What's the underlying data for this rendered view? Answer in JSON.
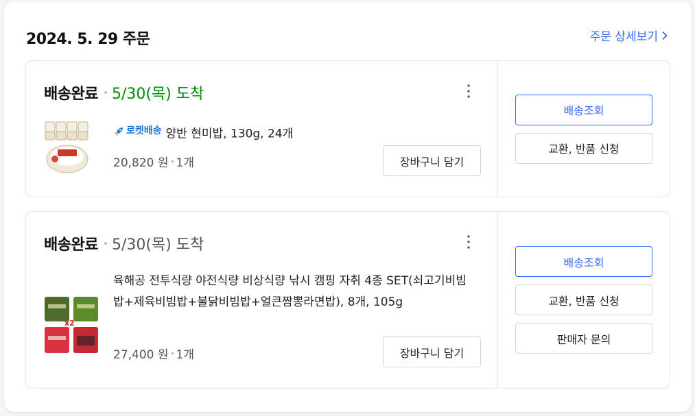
{
  "order": {
    "date": "2024. 5. 29 주문",
    "detail_link": "주문 상세보기"
  },
  "colors": {
    "accent": "#346aff",
    "arrival_green": "#008c00"
  },
  "shipments": [
    {
      "status": "배송완료",
      "arrival": "5/30(목) 도착",
      "arrival_color": "green",
      "product": {
        "badge": "로켓배송",
        "badge_icon": "rocket-icon",
        "title": "양반 현미밥, 130g, 24개",
        "price": "20,820 원",
        "quantity": "1개",
        "thumbnail": "brown-rice-bowls"
      },
      "cart_label": "장바구니 담기",
      "actions": [
        "배송조회",
        "교환, 반품 신청"
      ]
    },
    {
      "status": "배송완료",
      "arrival": "5/30(목) 도착",
      "arrival_color": "gray",
      "product": {
        "title": "육해공 전투식량 야전식량 비상식량 낚시 캠핑 자취 4종 SET(쇠고기비빔밥+제육비빔밥+불닭비빔밥+얼큰짬뽕라면밥), 8개, 105g",
        "price": "27,400 원",
        "quantity": "1개",
        "thumbnail": "ration-packs",
        "thumb_multiplier": "x2"
      },
      "cart_label": "장바구니 담기",
      "actions": [
        "배송조회",
        "교환, 반품 신청",
        "판매자 문의"
      ]
    }
  ]
}
